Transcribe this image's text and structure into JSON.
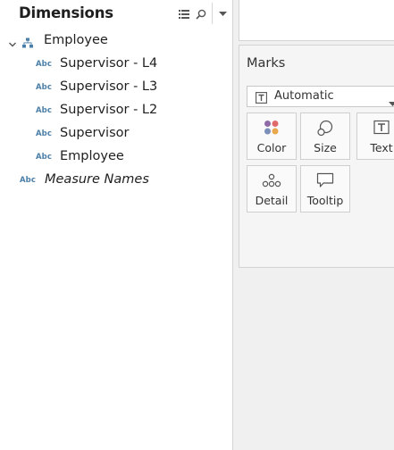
{
  "data_pane": {
    "title": "Dimensions",
    "icons": [
      "list-view-icon",
      "search-icon",
      "dropdown-arrow-icon"
    ],
    "hierarchy": {
      "label": "Employee",
      "expanded": true,
      "fields": [
        {
          "type_badge": "Abc",
          "label": "Supervisor - L4"
        },
        {
          "type_badge": "Abc",
          "label": "Supervisor - L3"
        },
        {
          "type_badge": "Abc",
          "label": "Supervisor - L2"
        },
        {
          "type_badge": "Abc",
          "label": "Supervisor"
        },
        {
          "type_badge": "Abc",
          "label": "Employee"
        }
      ]
    },
    "measure_names": {
      "type_badge": "Abc",
      "label": "Measure Names"
    }
  },
  "marks": {
    "title": "Marks",
    "mark_type": "Automatic",
    "buttons": [
      {
        "label": "Color",
        "icon": "color-dots-icon"
      },
      {
        "label": "Size",
        "icon": "size-circles-icon"
      },
      {
        "label": "Text",
        "icon": "text-icon"
      },
      {
        "label": "Detail",
        "icon": "detail-dots-icon"
      },
      {
        "label": "Tooltip",
        "icon": "tooltip-speech-icon"
      }
    ]
  },
  "colors": {
    "type_badge": "#4b7fa8",
    "color_dots": [
      "#8e6aa6",
      "#e06b6b",
      "#7b8fb8",
      "#e8a84b"
    ]
  }
}
